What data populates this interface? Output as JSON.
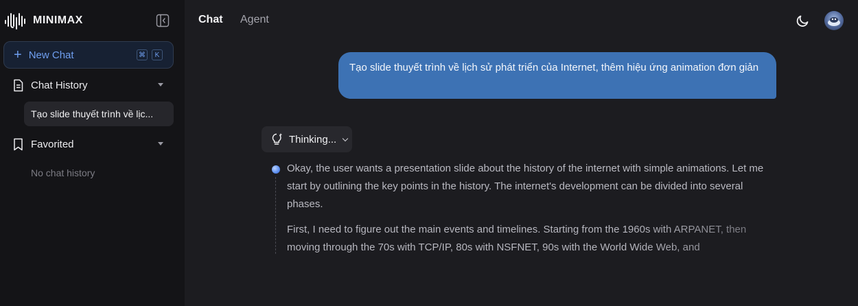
{
  "brand": {
    "name": "MINIMAX"
  },
  "sidebar": {
    "new_chat_label": "New Chat",
    "shortcut_keys": [
      "⌘",
      "K"
    ],
    "sections": [
      {
        "title": "Chat History",
        "items": [
          "Tạo slide thuyết trình về lịc..."
        ]
      },
      {
        "title": "Favorited",
        "empty_text": "No chat history"
      }
    ]
  },
  "header": {
    "tabs": [
      {
        "label": "Chat",
        "active": true
      },
      {
        "label": "Agent",
        "active": false
      }
    ],
    "icons": [
      "moon-icon",
      "avatar"
    ]
  },
  "conversation": {
    "user_message": "Tạo slide thuyết trình về lịch sử phát triển của Internet, thêm hiệu ứng animation đơn giản",
    "thinking_label": "Thinking...",
    "thought_paragraphs": [
      "Okay, the user wants a presentation slide about the history of the internet with simple animations. Let me start by outlining the key points in the history. The internet's development can be divided into several phases.",
      "First, I need to figure out the main events and timelines. Starting from the 1960s with ARPANET, then moving through the 70s with TCP/IP, 80s with NSFNET, 90s with the World Wide Web, and"
    ]
  },
  "colors": {
    "sidebar_bg": "#141417",
    "main_bg": "#1c1c20",
    "accent": "#6f9ff0",
    "user_bubble": "#3d72b4"
  }
}
